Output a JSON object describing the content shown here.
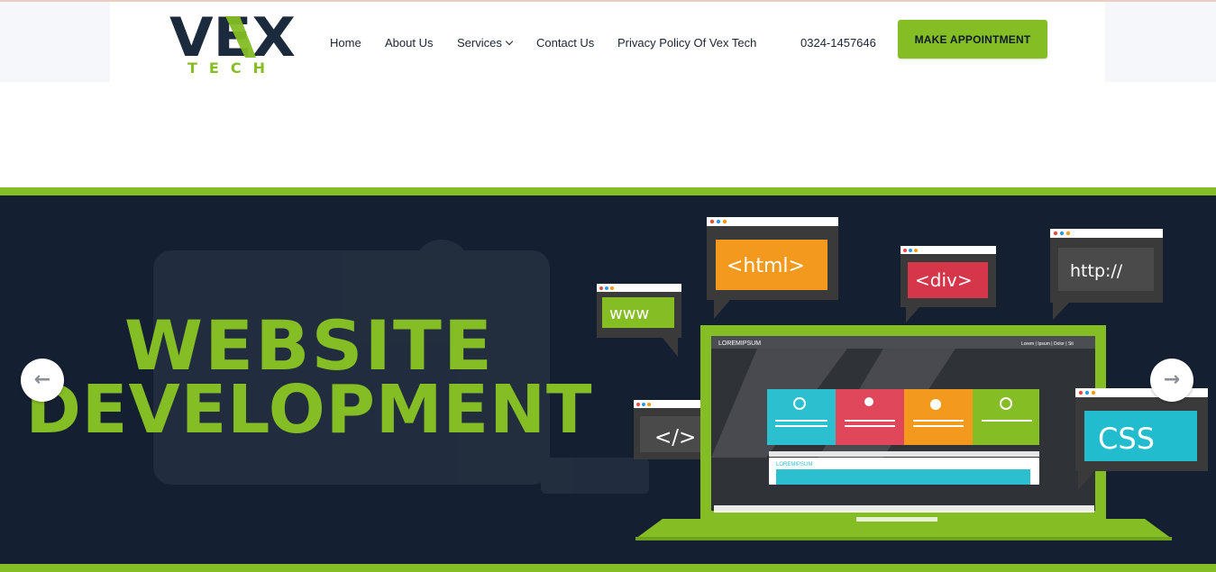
{
  "brand": {
    "logo_main": "VEX",
    "logo_sub": "TECH",
    "colors": {
      "green": "#84bd24",
      "navy": "#1b2a3d",
      "dark": "#142032"
    }
  },
  "nav": {
    "home": "Home",
    "about": "About Us",
    "services": "Services",
    "contact": "Contact Us",
    "privacy": "Privacy Policy Of Vex Tech"
  },
  "phone": "0324-1457646",
  "cta_label": "MAKE APPOINTMENT",
  "hero": {
    "line1": "WEBSITE",
    "line2": "DEVELOPMENT",
    "tags": {
      "www": "www",
      "html": "<html>",
      "div": "<div>",
      "http": "http://",
      "code": "</>",
      "css": "CSS"
    },
    "screen_brand": "LOREMIPSUM",
    "screen_nav": "Lorem | Ipsum | Dolor | Sit",
    "screen_brand2": "LOREMIPSUM"
  },
  "slider": {
    "prev_icon": "arrow-left-icon",
    "next_icon": "arrow-right-icon"
  }
}
